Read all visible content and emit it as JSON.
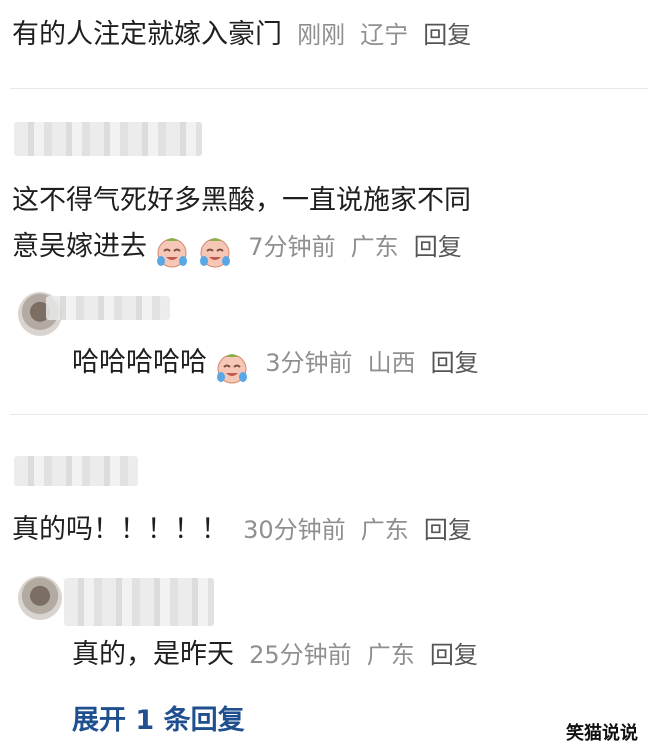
{
  "thread": {
    "top_comment": {
      "text": "有的人注定就嫁入豪门",
      "time": "刚刚",
      "location": "辽宁",
      "reply_label": "回复"
    },
    "comment_2": {
      "line1": "这不得气死好多黑酸，一直说施家不同",
      "line2": "意吴嫁进去",
      "emojis": [
        "crying-laughing-icon",
        "crying-laughing-icon"
      ],
      "time": "7分钟前",
      "location": "广东",
      "reply_label": "回复",
      "reply": {
        "text": "哈哈哈哈哈",
        "emoji": "crying-laughing-icon",
        "time": "3分钟前",
        "location": "山西",
        "reply_label": "回复"
      }
    },
    "comment_3": {
      "text": "真的吗！！！！！",
      "time": "30分钟前",
      "location": "广东",
      "reply_label": "回复",
      "reply": {
        "text": "真的，是昨天",
        "time": "25分钟前",
        "location": "广东",
        "reply_label": "回复"
      },
      "expand_label": "展开 1 条回复"
    }
  },
  "watermark": "笑猫说说",
  "colors": {
    "text": "#1f1f1f",
    "meta": "#8f8f8f",
    "link": "#1f4f8e",
    "divider": "#e8e8e8"
  }
}
